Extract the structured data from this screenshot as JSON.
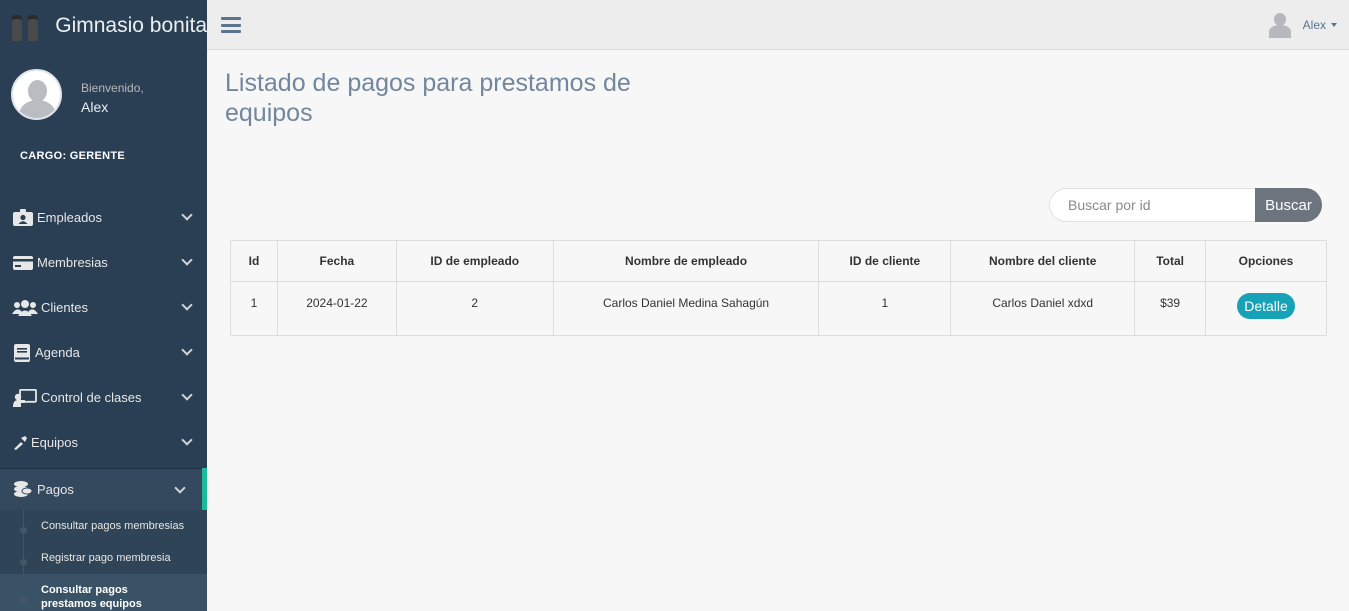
{
  "brand": {
    "title": "Gimnasio bonita"
  },
  "profile": {
    "welcome": "Bienvenido,",
    "name": "Alex",
    "cargo": "CARGO: GERENTE"
  },
  "menu": [
    {
      "label": "Empleados",
      "icon": "employee-badge-icon"
    },
    {
      "label": "Membresias",
      "icon": "credit-card-icon"
    },
    {
      "label": "Clientes",
      "icon": "users-icon"
    },
    {
      "label": "Agenda",
      "icon": "book-icon"
    },
    {
      "label": "Control de clases",
      "icon": "chalkboard-teacher-icon"
    },
    {
      "label": "Equipos",
      "icon": "tools-icon"
    },
    {
      "label": "Pagos",
      "icon": "coins-icon"
    }
  ],
  "submenu": [
    {
      "label": "Consultar pagos membresias"
    },
    {
      "label": "Registrar pago membresia"
    },
    {
      "label": "Consultar pagos prestamos equipos"
    }
  ],
  "topbar": {
    "user": "Alex"
  },
  "page": {
    "title": "Listado de pagos para prestamos de equipos"
  },
  "search": {
    "placeholder": "Buscar por id",
    "button": "Buscar"
  },
  "table": {
    "headers": [
      "Id",
      "Fecha",
      "ID de empleado",
      "Nombre de empleado",
      "ID de cliente",
      "Nombre del cliente",
      "Total",
      "Opciones"
    ],
    "rows": [
      {
        "id": "1",
        "fecha": "2024-01-22",
        "id_empleado": "2",
        "nombre_empleado": "Carlos Daniel Medina Sahagún",
        "id_cliente": "1",
        "nombre_cliente": "Carlos Daniel xdxd",
        "total": "$39",
        "accion": "Detalle"
      }
    ]
  },
  "colors": {
    "sidebar": "#2a3f54",
    "accent": "#1abb9c",
    "button_info": "#17a2b8",
    "button_secondary": "#6c757d",
    "title": "#73879c"
  }
}
